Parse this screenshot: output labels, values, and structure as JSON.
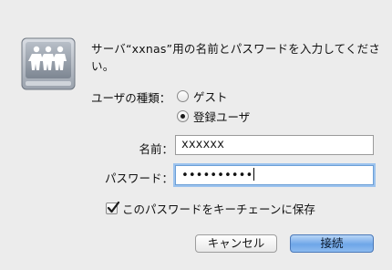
{
  "dialog": {
    "message": "サーバ“xxnas”用の名前とパスワードを入力してください。",
    "user_type_label": "ユーザの種類：",
    "user_types": [
      {
        "label": "ゲスト",
        "selected": false
      },
      {
        "label": "登録ユーザ",
        "selected": true
      }
    ],
    "name_label": "名前：",
    "name_value": "xxxxxx",
    "password_label": "パスワード：",
    "password_masked": "••••••••••",
    "save_keychain_label": "このパスワードをキーチェーンに保存",
    "save_keychain_checked": true,
    "cancel_label": "キャンセル",
    "connect_label": "接続"
  },
  "icon": {
    "name": "network-server-icon"
  },
  "colors": {
    "accent": "#6ea6e8",
    "focus_ring": "#9cc3ee"
  }
}
